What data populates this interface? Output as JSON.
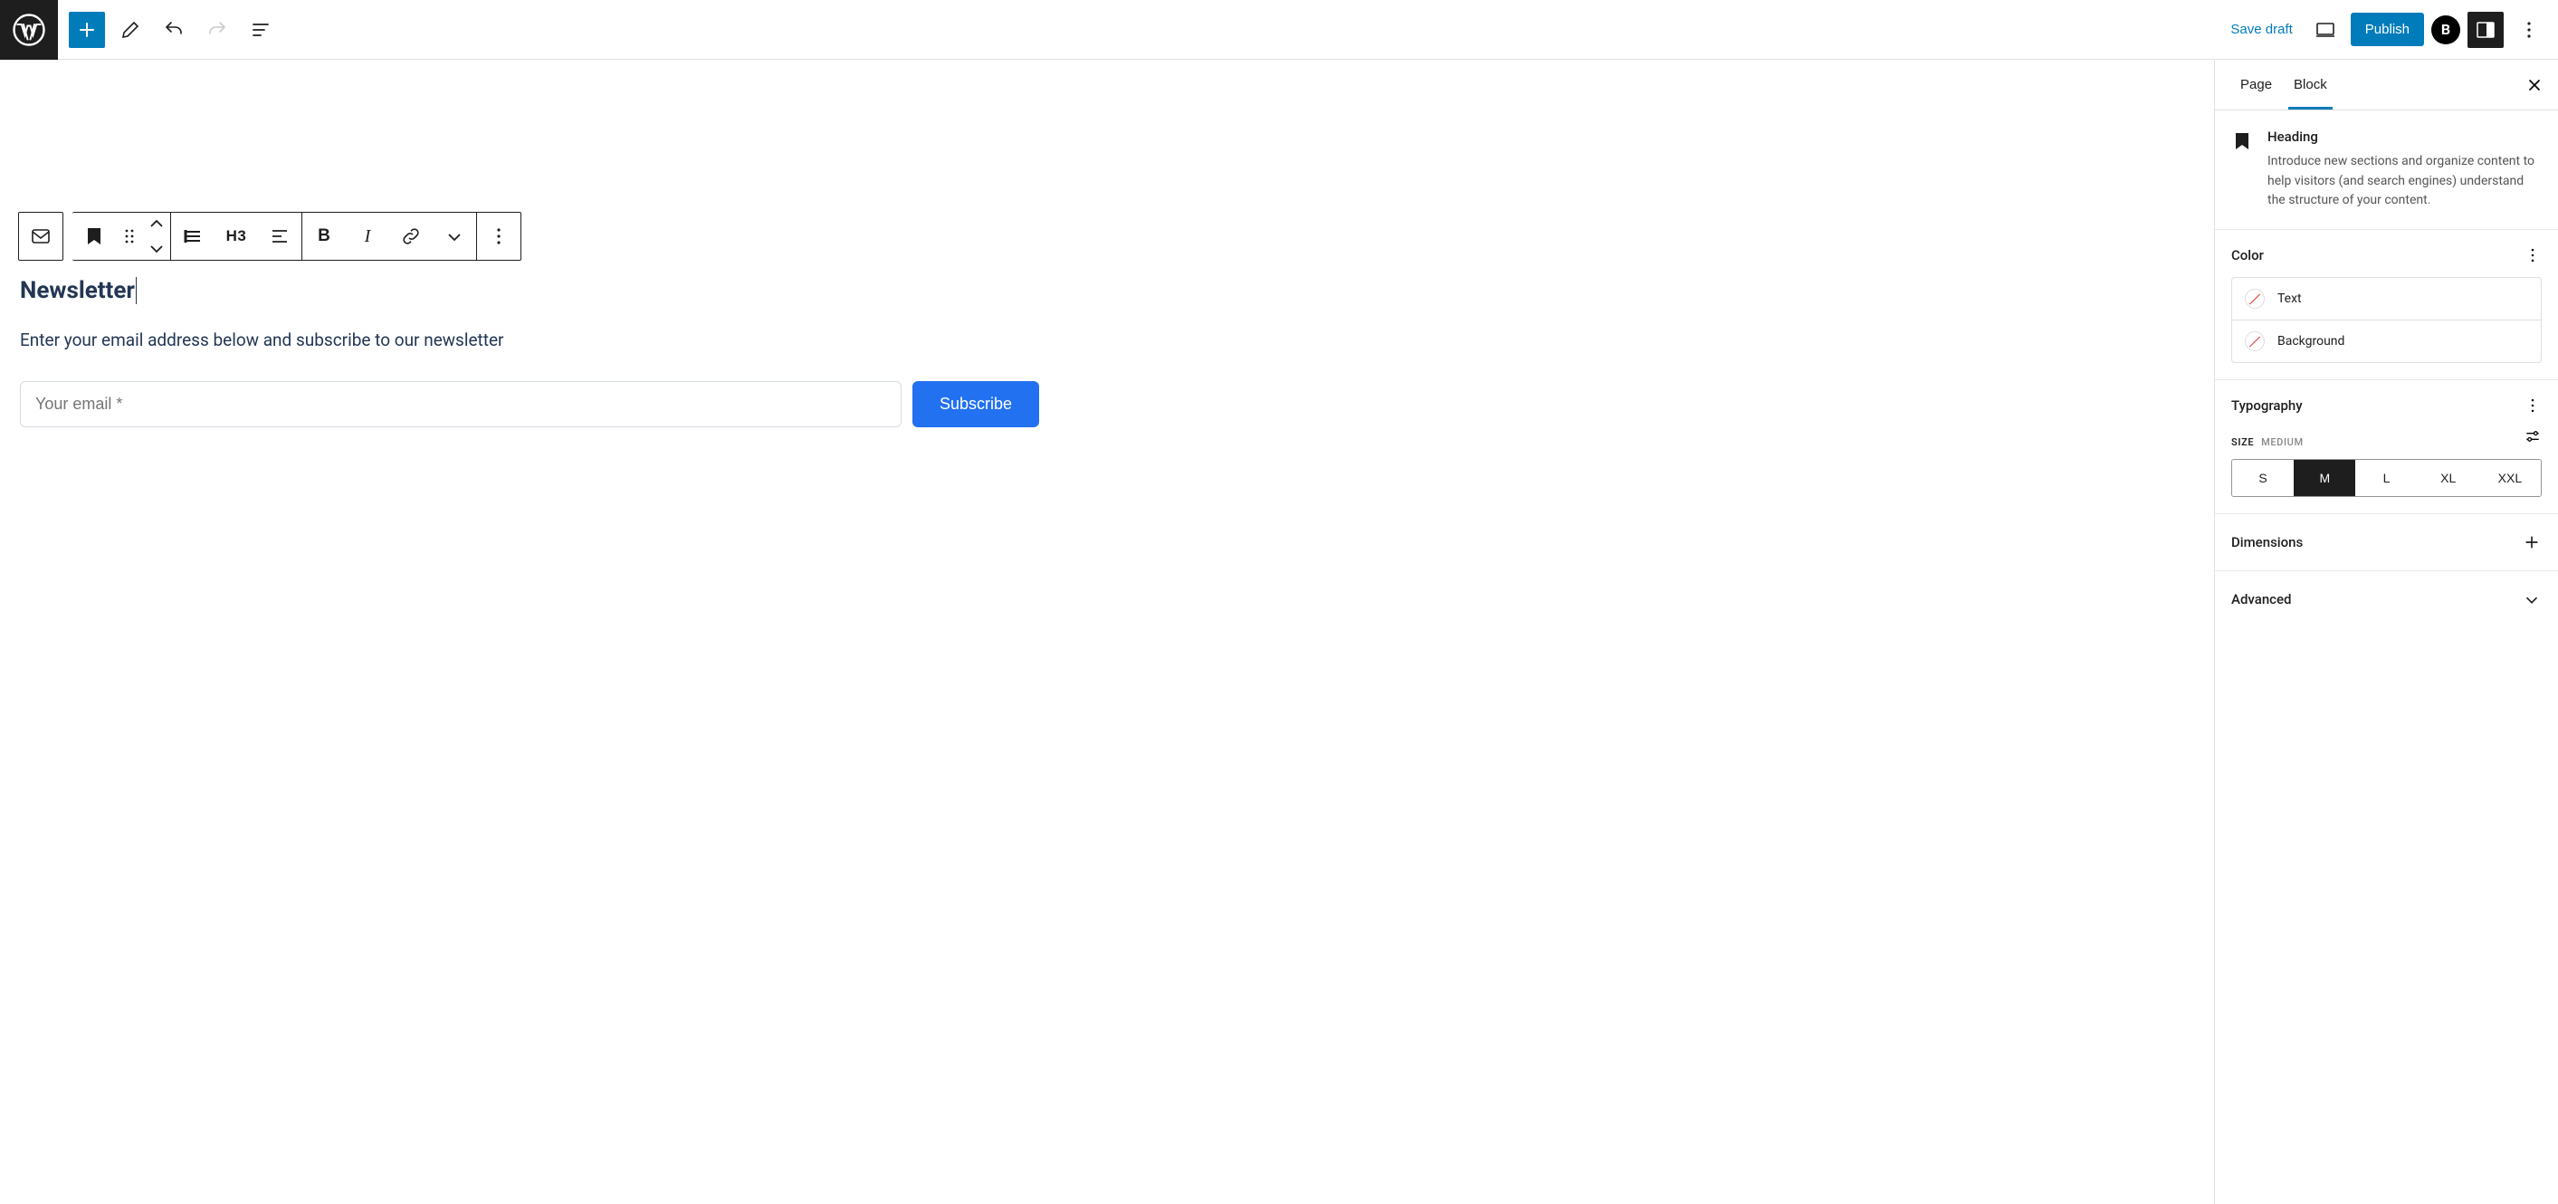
{
  "topbar": {
    "save_draft": "Save draft",
    "publish": "Publish"
  },
  "block_toolbar": {
    "heading_level": "H3",
    "bold": "B",
    "italic": "I"
  },
  "editor": {
    "heading_text": "Newsletter",
    "paragraph_text": "Enter your email address below and subscribe to our newsletter",
    "email_placeholder": "Your email *",
    "subscribe_label": "Subscribe"
  },
  "sidebar": {
    "tabs": {
      "page": "Page",
      "block": "Block"
    },
    "block_info": {
      "title": "Heading",
      "description": "Introduce new sections and organize content to help visitors (and search engines) understand the structure of your content."
    },
    "panels": {
      "color": {
        "title": "Color",
        "items": {
          "text": "Text",
          "background": "Background"
        }
      },
      "typography": {
        "title": "Typography",
        "size_label": "Size",
        "size_value": "Medium",
        "options": [
          "S",
          "M",
          "L",
          "XL",
          "XXL"
        ],
        "active_option": "M"
      },
      "dimensions": "Dimensions",
      "advanced": "Advanced"
    }
  }
}
